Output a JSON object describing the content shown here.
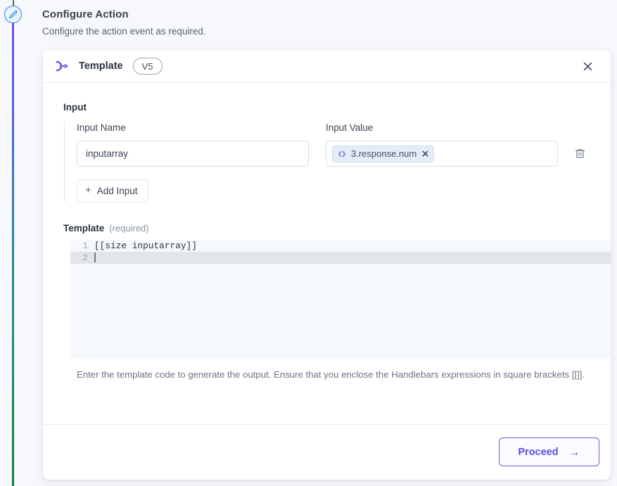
{
  "page": {
    "title": "Configure Action",
    "subtitle": "Configure the action event as required."
  },
  "rail": {
    "node_icon": "pencil-icon",
    "gradient_from": "#6c4ff0",
    "gradient_to": "#05853c",
    "node_border_color": "#2e86f0"
  },
  "card": {
    "header": {
      "icon": "template-flow-icon",
      "title": "Template",
      "version": "V5",
      "close_icon": "close-icon"
    },
    "input_section": {
      "label": "Input",
      "name_label": "Input Name",
      "value_label": "Input Value",
      "name_value": "inputarray",
      "name_placeholder": "Input Name",
      "chip": {
        "icon": "code-icon",
        "text": "3.response.num",
        "remove_icon": "close-icon"
      },
      "delete_icon": "trash-icon",
      "add_input_label": "Add Input",
      "add_input_icon": "plus-icon"
    },
    "template_section": {
      "label": "Template",
      "required_text": "(required)",
      "lines": [
        {
          "number": "1",
          "code": "[[size inputarray]]",
          "active": false
        },
        {
          "number": "2",
          "code": "",
          "active": true
        }
      ],
      "line1_number": "1",
      "line1_code": "[[size inputarray]]",
      "line2_number": "2",
      "line2_code": "",
      "helper_text": "Enter the template code to generate the output. Ensure that you enclose the Handlebars expressions in square brackets [[]]."
    },
    "footer": {
      "proceed_label": "Proceed",
      "proceed_arrow": "→",
      "accent_color": "#6c5ce7"
    }
  }
}
